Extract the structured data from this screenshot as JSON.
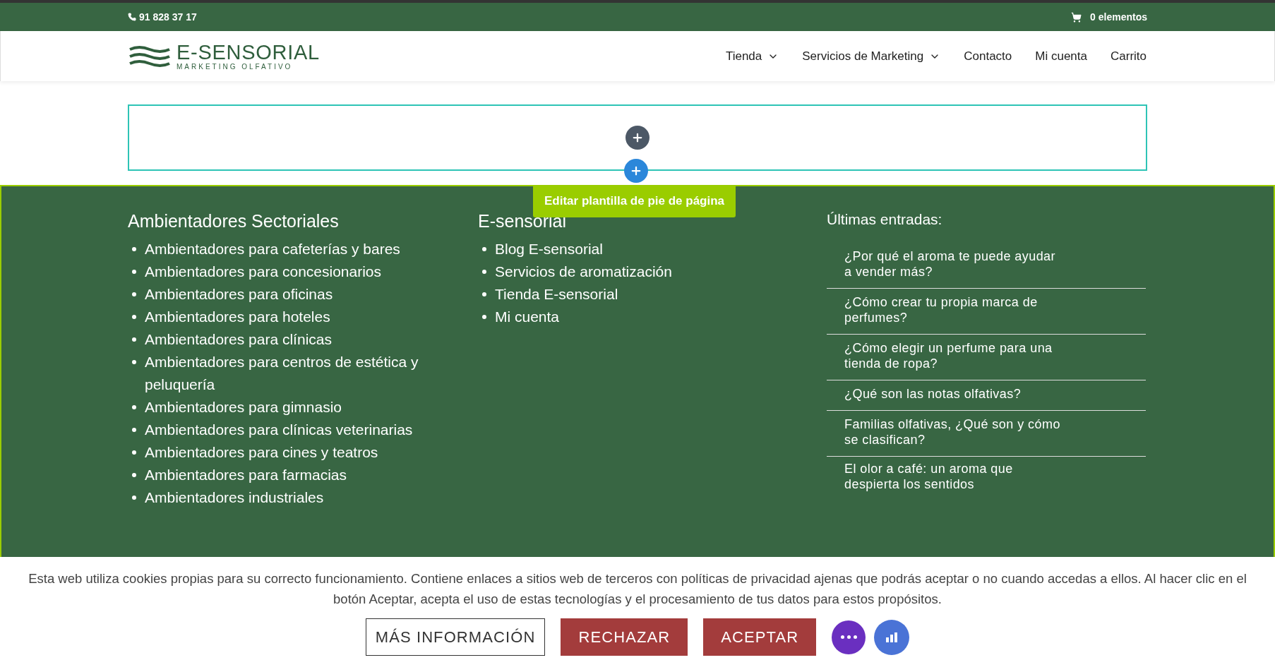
{
  "top_bar": {
    "phone": "91 828 37 17",
    "cart": "0 elementos"
  },
  "header": {
    "logo_title": "E-SENSORIAL",
    "logo_subtitle": "MARKETING OLFATIVO",
    "nav": [
      {
        "label": "Tienda",
        "has_menu": true
      },
      {
        "label": "Servicios de Marketing",
        "has_menu": true
      },
      {
        "label": "Contacto",
        "has_menu": false
      },
      {
        "label": "Mi cuenta",
        "has_menu": false
      },
      {
        "label": "Carrito",
        "has_menu": false
      }
    ]
  },
  "builder": {
    "edit_footer_label": "Editar plantilla de pie de página"
  },
  "footer": {
    "columns": [
      {
        "kind": "bullets",
        "title": "Ambientadores Sectoriales",
        "items": [
          "Ambientadores para cafeterías y bares",
          "Ambientadores para concesionarios",
          "Ambientadores para oficinas",
          "Ambientadores para hoteles",
          "Ambientadores para clínicas",
          "Ambientadores para centros de estética y peluquería",
          "Ambientadores para gimnasio",
          "Ambientadores para clínicas veterinarias",
          "Ambientadores para cines y teatros",
          "Ambientadores para farmacias",
          "Ambientadores industriales"
        ]
      },
      {
        "kind": "bullets",
        "title": "E-sensorial",
        "items": [
          "Blog E-sensorial",
          "Servicios de aromatización",
          "Tienda E-sensorial",
          "Mi cuenta"
        ]
      },
      {
        "kind": "posts",
        "title": "Últimas entradas:",
        "items": [
          "¿Por qué el aroma te puede ayudar a vender más?",
          "¿Cómo crear tu propia marca de perfumes?",
          "¿Cómo elegir un perfume para una tienda de ropa?",
          "¿Qué son las notas olfativas?",
          "Familias olfativas, ¿Qué son y cómo se clasifican?",
          "El olor a café: un aroma que despierta los sentidos"
        ]
      }
    ]
  },
  "cookie_bar": {
    "text": "Esta web utiliza cookies propias para su correcto funcionamiento. Contiene enlaces a sitios web de terceros con políticas de privacidad ajenas que podrás aceptar o no cuando accedas a ellos. Al hacer clic en el botón Aceptar, acepta el uso de estas tecnologías y el procesamiento de tus datos para estos propósitos.",
    "buttons": [
      {
        "label": "MÁS INFORMACIÓN",
        "kind": "outline"
      },
      {
        "label": "RECHAZAR",
        "kind": "filled"
      },
      {
        "label": "ACEPTAR",
        "kind": "filled"
      }
    ]
  }
}
